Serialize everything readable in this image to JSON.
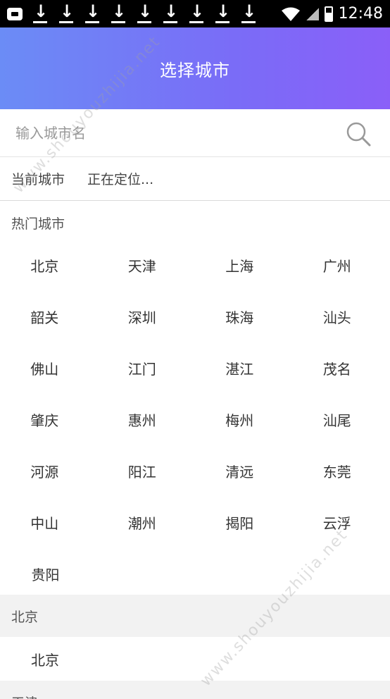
{
  "status_bar": {
    "time": "12:48",
    "icons": [
      "app-notification-icon",
      "download-icon",
      "download-icon",
      "download-icon",
      "download-icon",
      "download-icon",
      "download-icon",
      "download-icon",
      "download-icon",
      "download-icon",
      "wifi-icon",
      "signal-icon",
      "battery-icon"
    ]
  },
  "header": {
    "title": "选择城市"
  },
  "search": {
    "placeholder": "输入城市名",
    "value": ""
  },
  "current": {
    "label": "当前城市",
    "status": "正在定位..."
  },
  "hot": {
    "title": "热门城市",
    "rows": [
      [
        "北京",
        "天津",
        "上海",
        "广州"
      ],
      [
        "韶关",
        "深圳",
        "珠海",
        "汕头"
      ],
      [
        "佛山",
        "江门",
        "湛江",
        "茂名"
      ],
      [
        "肇庆",
        "惠州",
        "梅州",
        "汕尾"
      ],
      [
        "河源",
        "阳江",
        "清远",
        "东莞"
      ],
      [
        "中山",
        "潮州",
        "揭阳",
        "云浮"
      ],
      [
        "贵阳"
      ]
    ]
  },
  "sections": [
    {
      "header": "北京",
      "cities": [
        "北京"
      ]
    },
    {
      "header": "天津",
      "cities": []
    }
  ],
  "watermark": "www.shouyouzhijia.net",
  "colors": {
    "header_start": "#6b8cf6",
    "header_end": "#8a5ff8",
    "section_bg": "#f2f2f2"
  }
}
